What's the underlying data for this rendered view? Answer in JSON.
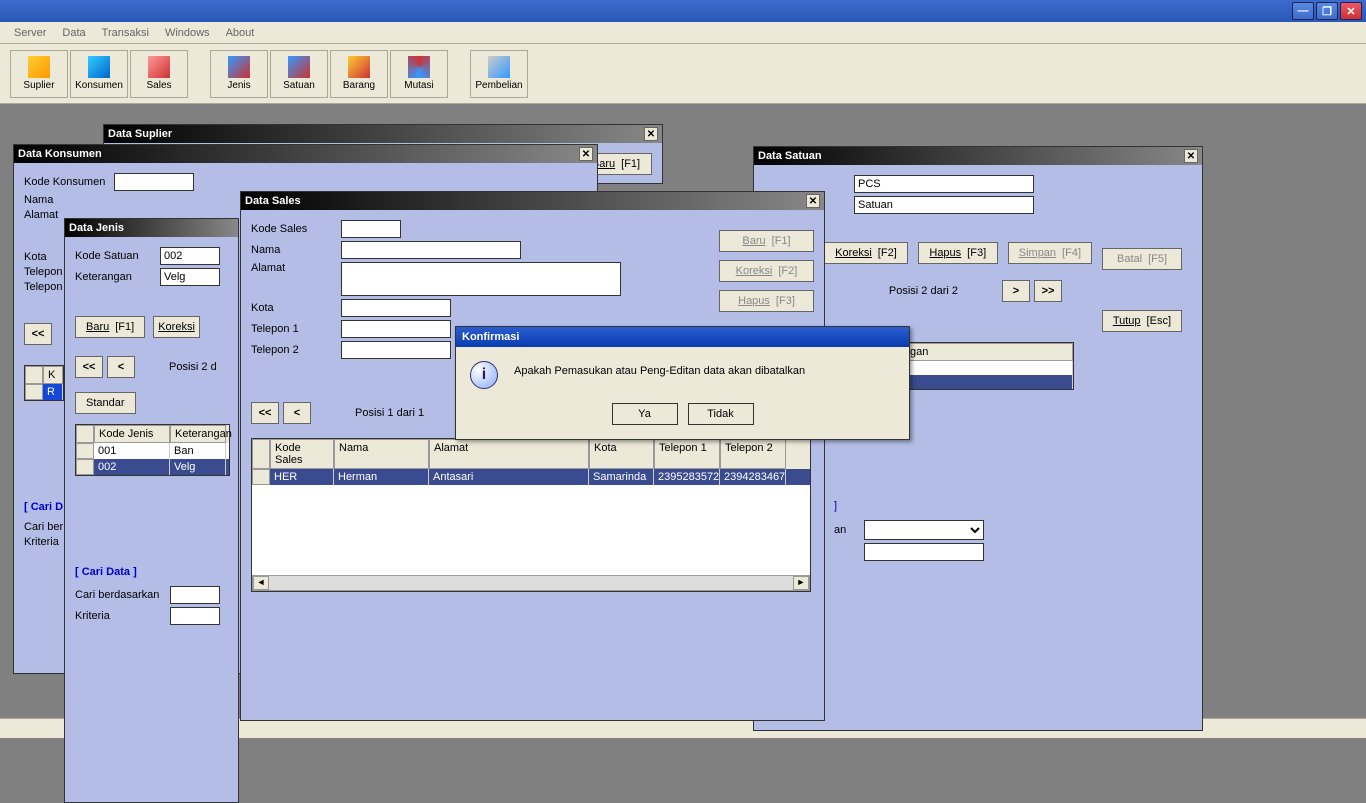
{
  "menu": {
    "server": "Server",
    "data": "Data",
    "transaksi": "Transaksi",
    "windows": "Windows",
    "about": "About"
  },
  "toolbar": {
    "suplier": "Suplier",
    "konsumen": "Konsumen",
    "sales": "Sales",
    "jenis": "Jenis",
    "satuan": "Satuan",
    "barang": "Barang",
    "mutasi": "Mutasi",
    "pembelian": "Pembelian"
  },
  "btn": {
    "baru": "Baru",
    "baru_key": "[F1]",
    "koreksi": "Koreksi",
    "koreksi_key": "[F2]",
    "hapus": "Hapus",
    "hapus_key": "[F3]",
    "simpan": "Simpan",
    "simpan_key": "[F4]",
    "batal": "Batal",
    "batal_key": "[F5]",
    "tutup": "Tutup",
    "tutup_key": "[Esc]",
    "standar": "Standar",
    "ya": "Ya",
    "tidak": "Tidak"
  },
  "nav": {
    "first": "<<",
    "prev": "<",
    "next": ">",
    "last": ">>"
  },
  "win_suplier": {
    "title": "Data Suplier"
  },
  "win_konsumen": {
    "title": "Data Konsumen",
    "labels": {
      "kode": "Kode Konsumen",
      "nama": "Nama",
      "alamat": "Alamat",
      "kota": "Kota",
      "telepon": "Telepon",
      "telepon2": "Telepon"
    },
    "col_k": "K",
    "row_r": "R"
  },
  "win_jenis": {
    "title": "Data Jenis",
    "labels": {
      "kode": "Kode Satuan",
      "keterangan": "Keterangan"
    },
    "values": {
      "kode": "002",
      "keterangan": "Velg"
    },
    "position": "Posisi 2 d",
    "cols": {
      "kode": "Kode Jenis",
      "ket": "Keterangan"
    },
    "rows": [
      {
        "kode": "001",
        "ket": "Ban"
      },
      {
        "kode": "002",
        "ket": "Velg"
      }
    ],
    "cari_d": "[ Cari D",
    "cari_ber": "Cari ber",
    "kriteria": "Kriteria",
    "search": {
      "title": "[ Cari Data ]",
      "cari_berdasarkan": "Cari berdasarkan",
      "kriteria": "Kriteria"
    }
  },
  "win_sales": {
    "title": "Data Sales",
    "labels": {
      "kode": "Kode Sales",
      "nama": "Nama",
      "alamat": "Alamat",
      "kota": "Kota",
      "tel1": "Telepon 1",
      "tel2": "Telepon 2"
    },
    "position": "Posisi 1 dari 1",
    "cols": {
      "kode": "Kode Sales",
      "nama": "Nama",
      "alamat": "Alamat",
      "kota": "Kota",
      "tel1": "Telepon 1",
      "tel2": "Telepon 2"
    },
    "rows": [
      {
        "kode": "HER",
        "nama": "Herman",
        "alamat": "Antasari",
        "kota": "Samarinda",
        "tel1": "2395283572",
        "tel2": "2394283467"
      }
    ]
  },
  "win_satuan": {
    "title": "Data Satuan",
    "values": {
      "kode": "PCS",
      "keterangan": "Satuan"
    },
    "position": "Posisi 2 dari 2",
    "col_frag": "gan",
    "frag_an": "an"
  },
  "dialog": {
    "title": "Konfirmasi",
    "message": "Apakah Pemasukan atau Peng-Editan data akan dibatalkan"
  }
}
